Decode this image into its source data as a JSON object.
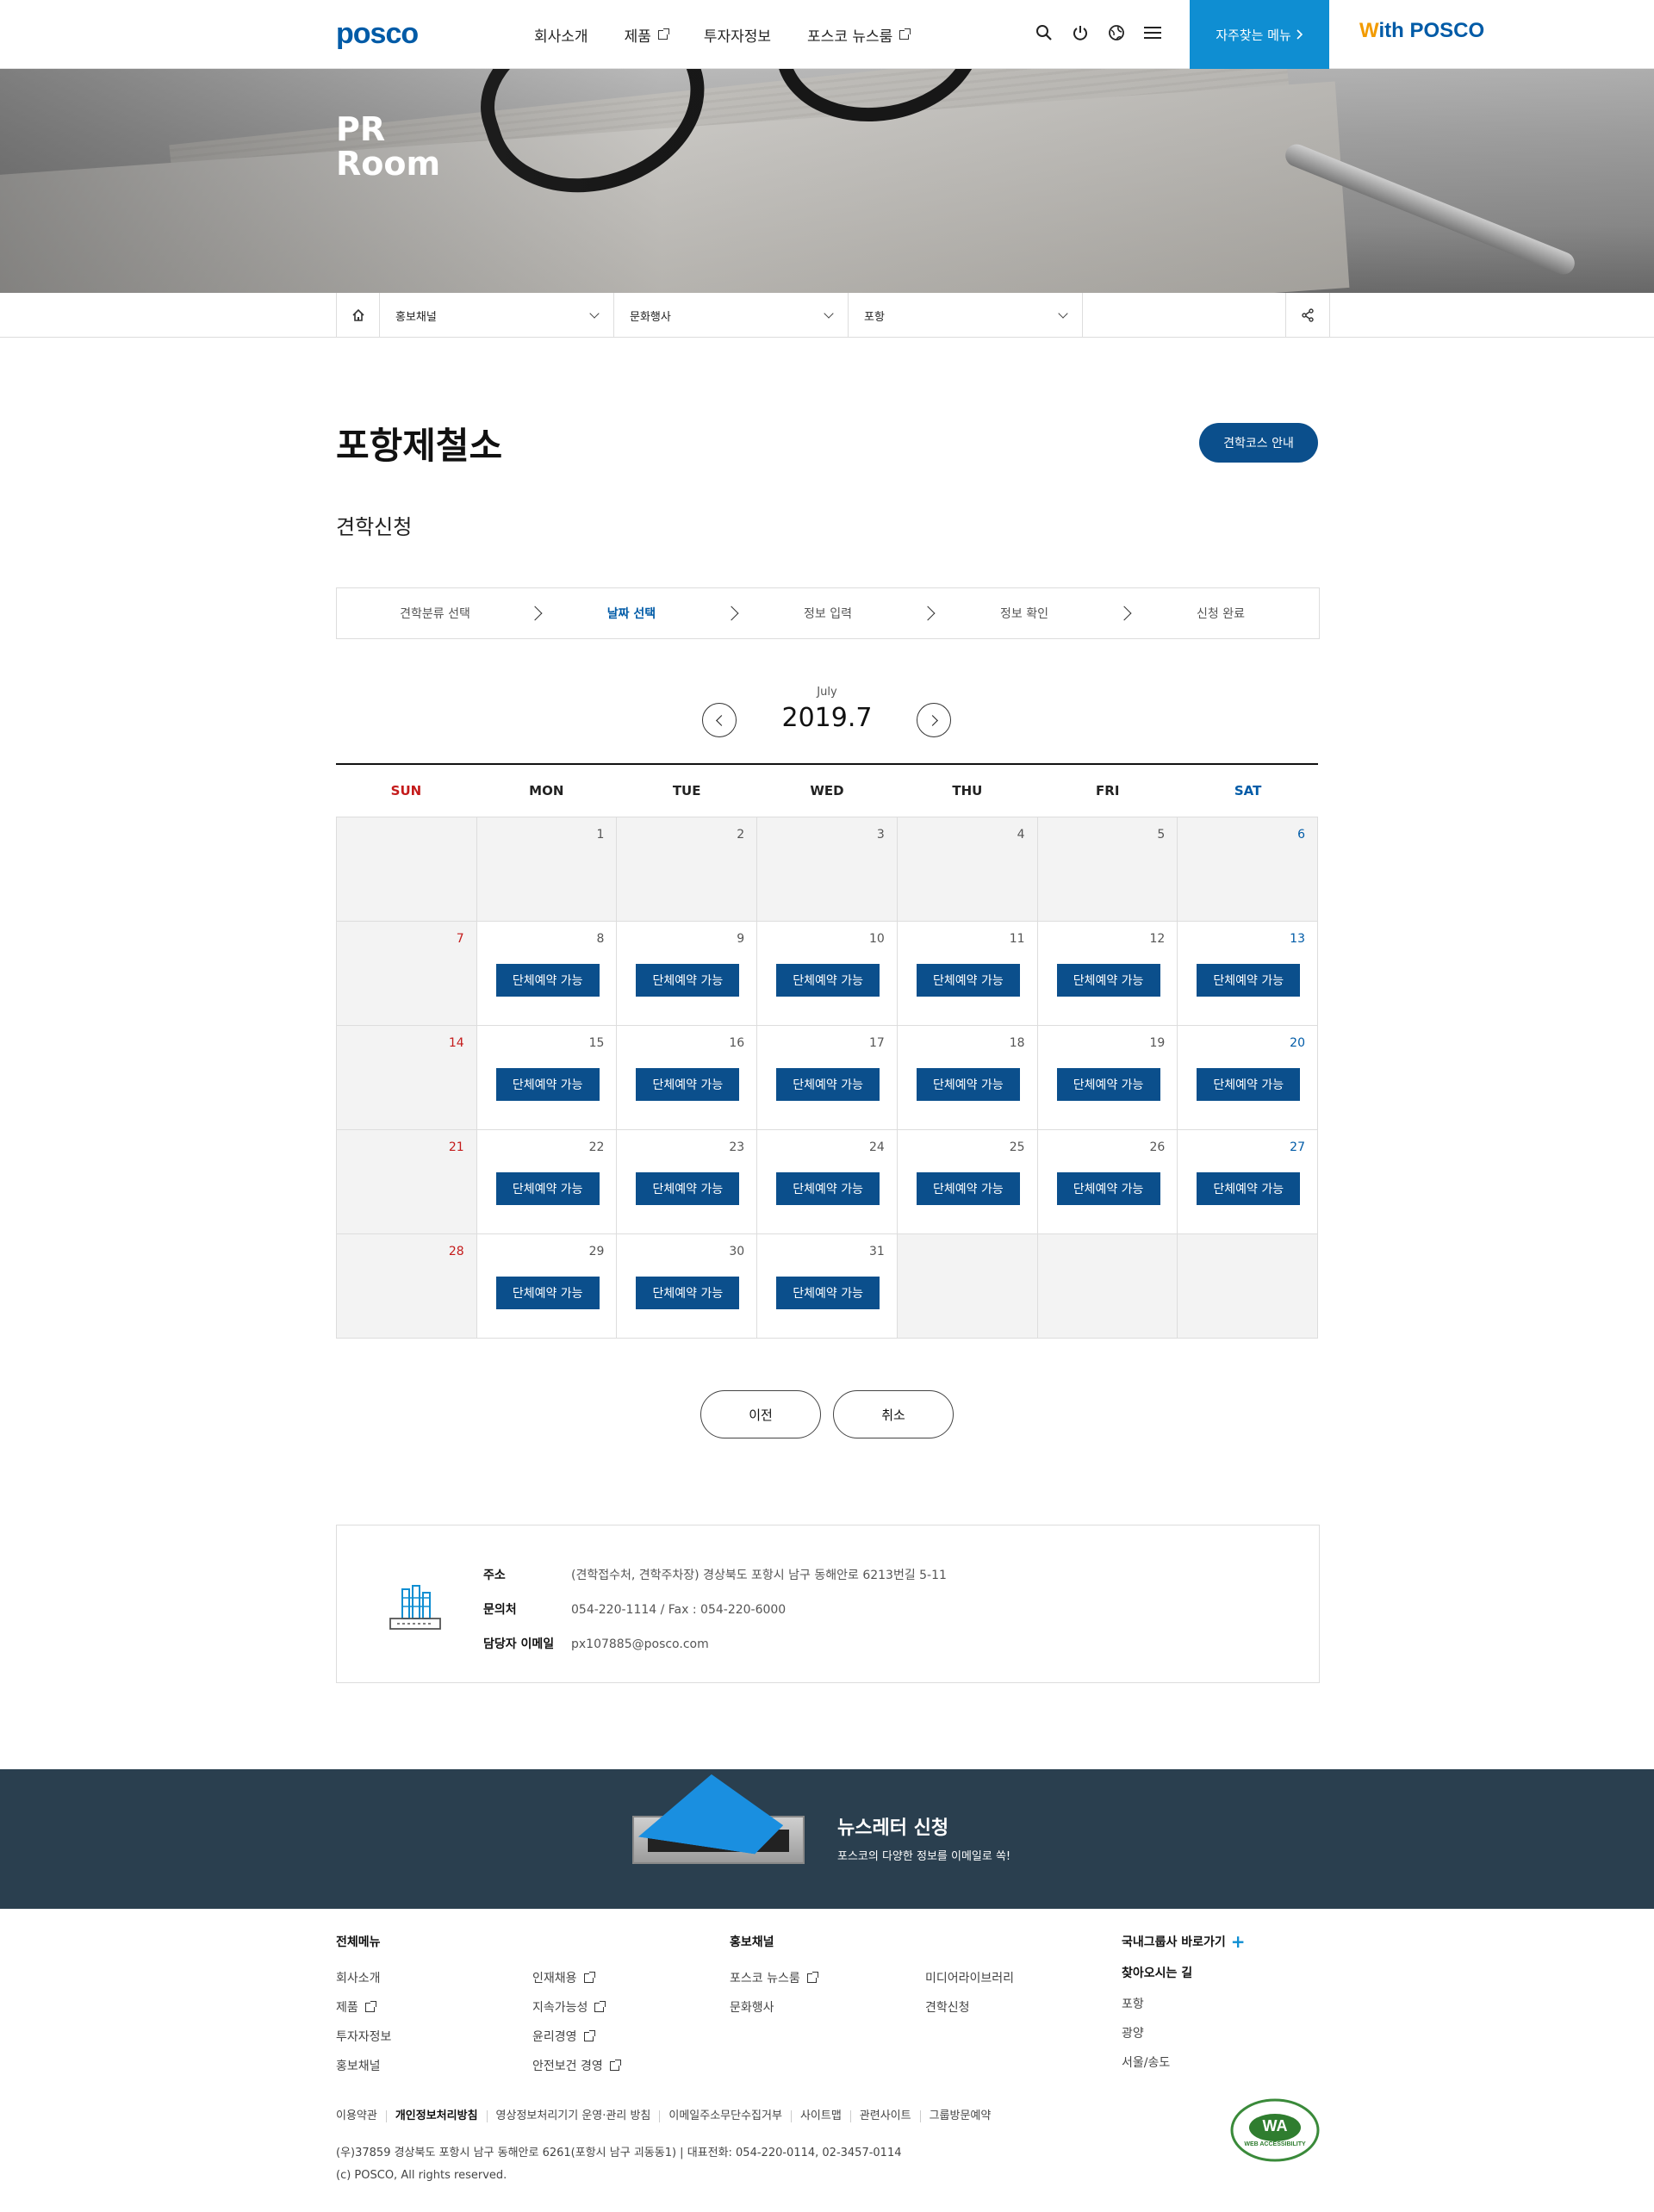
{
  "header": {
    "logo": "posco",
    "nav": [
      {
        "label": "회사소개",
        "external": false
      },
      {
        "label": "제품",
        "external": true
      },
      {
        "label": "투자자정보",
        "external": false
      },
      {
        "label": "포스코 뉴스룸",
        "external": true
      }
    ],
    "icons": [
      "search-icon",
      "power-icon",
      "globe-icon",
      "menu-icon"
    ],
    "quick_menu": "자주찾는 메뉴",
    "with_posco_w": "W",
    "with_posco_rest": "ith POSCO"
  },
  "banner": {
    "line1": "PR",
    "line2": "Room"
  },
  "location": {
    "items": [
      "홍보채널",
      "문화행사",
      "포항"
    ]
  },
  "page": {
    "title": "포항제철소",
    "course_button": "견학코스 안내",
    "subtitle": "견학신청"
  },
  "steps": [
    {
      "label": "견학분류 선택",
      "active": false
    },
    {
      "label": "날짜 선택",
      "active": true
    },
    {
      "label": "정보 입력",
      "active": false
    },
    {
      "label": "정보 확인",
      "active": false
    },
    {
      "label": "신청 완료",
      "active": false
    }
  ],
  "calendar": {
    "month_en": "July",
    "month_label": "2019.7",
    "days_of_week": [
      "SUN",
      "MON",
      "TUE",
      "WED",
      "THU",
      "FRI",
      "SAT"
    ],
    "reserve_label": "단체예약 가능",
    "weeks": [
      [
        {
          "day": "",
          "avail": false,
          "dim": true
        },
        {
          "day": "1",
          "avail": false,
          "dim": true
        },
        {
          "day": "2",
          "avail": false,
          "dim": true
        },
        {
          "day": "3",
          "avail": false,
          "dim": true
        },
        {
          "day": "4",
          "avail": false,
          "dim": true
        },
        {
          "day": "5",
          "avail": false,
          "dim": true
        },
        {
          "day": "6",
          "avail": false,
          "dim": true
        }
      ],
      [
        {
          "day": "7",
          "avail": false,
          "dim": true
        },
        {
          "day": "8",
          "avail": true
        },
        {
          "day": "9",
          "avail": true
        },
        {
          "day": "10",
          "avail": true
        },
        {
          "day": "11",
          "avail": true
        },
        {
          "day": "12",
          "avail": true
        },
        {
          "day": "13",
          "avail": true
        }
      ],
      [
        {
          "day": "14",
          "avail": false,
          "dim": true
        },
        {
          "day": "15",
          "avail": true
        },
        {
          "day": "16",
          "avail": true
        },
        {
          "day": "17",
          "avail": true
        },
        {
          "day": "18",
          "avail": true
        },
        {
          "day": "19",
          "avail": true
        },
        {
          "day": "20",
          "avail": true
        }
      ],
      [
        {
          "day": "21",
          "avail": false,
          "dim": true
        },
        {
          "day": "22",
          "avail": true
        },
        {
          "day": "23",
          "avail": true
        },
        {
          "day": "24",
          "avail": true
        },
        {
          "day": "25",
          "avail": true
        },
        {
          "day": "26",
          "avail": true
        },
        {
          "day": "27",
          "avail": true
        }
      ],
      [
        {
          "day": "28",
          "avail": false,
          "dim": true
        },
        {
          "day": "29",
          "avail": true
        },
        {
          "day": "30",
          "avail": true
        },
        {
          "day": "31",
          "avail": true
        },
        {
          "day": "",
          "avail": false,
          "dim": true
        },
        {
          "day": "",
          "avail": false,
          "dim": true
        },
        {
          "day": "",
          "avail": false,
          "dim": true
        }
      ]
    ]
  },
  "buttons": {
    "prev": "이전",
    "cancel": "취소"
  },
  "info": {
    "address_label": "주소",
    "address": "(견학접수처, 견학주차장) 경상북도 포항시 남구 동해안로 6213번길 5-11",
    "contact_label": "문의처",
    "contact": "054-220-1114 / Fax : 054-220-6000",
    "email_label": "담당자 이메일",
    "email": "px107885@posco.com"
  },
  "newsletter": {
    "title": "뉴스레터 신청",
    "subtitle": "포스코의 다양한 정보를 이메일로 쏙!"
  },
  "footer": {
    "all_menu_title": "전체메뉴",
    "col1": [
      {
        "label": "회사소개",
        "external": false
      },
      {
        "label": "제품",
        "external": true
      },
      {
        "label": "투자자정보",
        "external": false
      },
      {
        "label": "홍보채널",
        "external": false
      }
    ],
    "col2": [
      {
        "label": "인재채용",
        "external": true
      },
      {
        "label": "지속가능성",
        "external": true
      },
      {
        "label": "윤리경영",
        "external": true
      },
      {
        "label": "안전보건 경영",
        "external": true
      }
    ],
    "pr_title": "홍보채널",
    "col3": [
      {
        "label": "포스코 뉴스룸",
        "external": true
      },
      {
        "label": "문화행사",
        "external": false
      }
    ],
    "col4": [
      {
        "label": "미디어라이브러리",
        "external": false
      },
      {
        "label": "견학신청",
        "external": false
      }
    ],
    "group_title": "국내그룹사 바로가기",
    "visit_title": "찾아오시는 길",
    "visit_items": [
      "포항",
      "광양",
      "서울/송도"
    ],
    "policy_links": [
      {
        "label": "이용약관",
        "bold": false
      },
      {
        "label": "개인정보처리방침",
        "bold": true
      },
      {
        "label": "영상정보처리기기 운영·관리 방침",
        "bold": false
      },
      {
        "label": "이메일주소무단수집거부",
        "bold": false
      },
      {
        "label": "사이트맵",
        "bold": false
      },
      {
        "label": "관련사이트",
        "bold": false
      },
      {
        "label": "그룹방문예약",
        "bold": false
      }
    ],
    "address": "(우)37859 경상북도 포항시 남구 동해안로 6261(포항시 남구 괴동동1)  |  대표전화: 054-220-0114, 02-3457-0114",
    "copyright": "(c) POSCO, All rights reserved.",
    "wa_badge": "WA",
    "wa_text": "WEB ACCESSIBILITY"
  },
  "colors": {
    "brand_blue": "#005ba7",
    "button_navy": "#0b4f8c",
    "quick_blue": "#0f8ed2",
    "sunday_red": "#c41b1b",
    "newsletter_bg": "#2a3f4f"
  }
}
